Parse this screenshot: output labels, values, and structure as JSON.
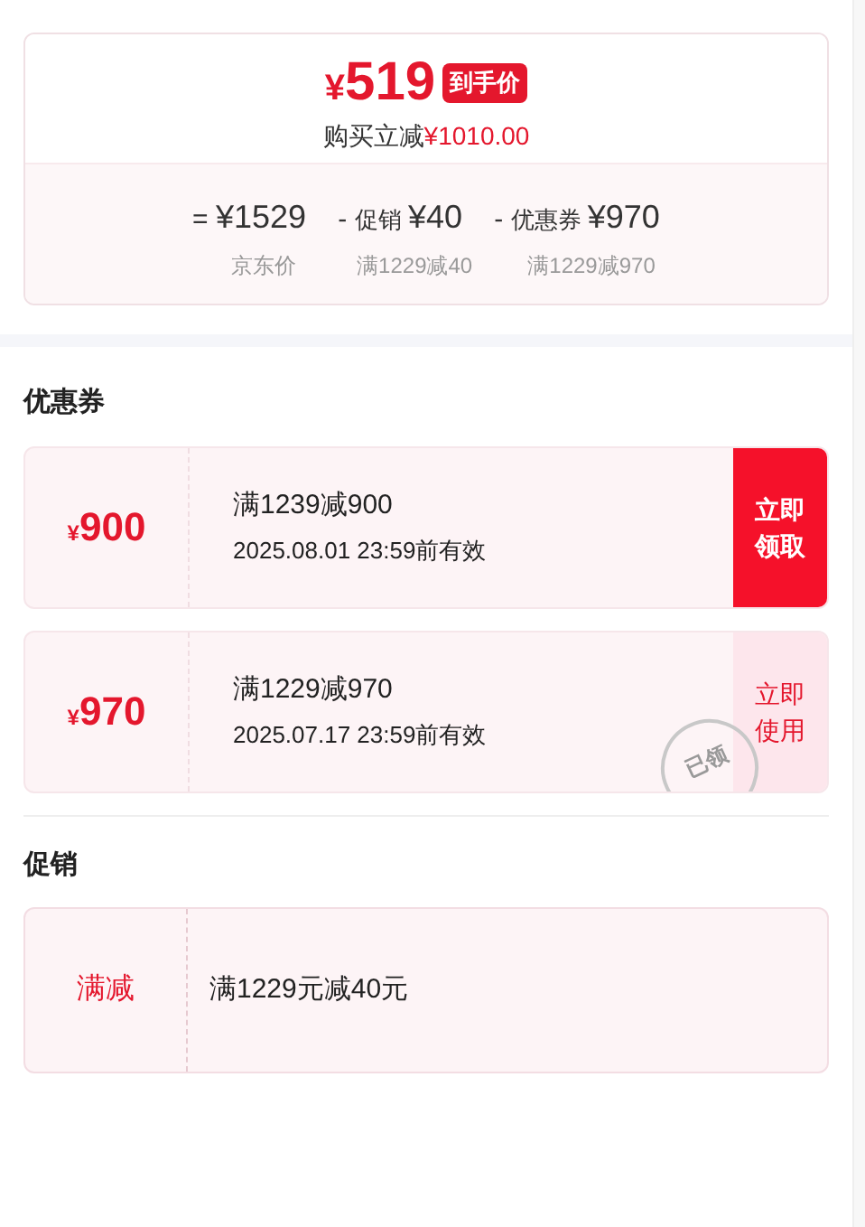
{
  "summary": {
    "currency": "¥",
    "price": "519",
    "badge": "到手价",
    "saving_label": "购买立减",
    "saving_value": "¥1010.00",
    "breakdown": [
      {
        "sign": "=",
        "amount": "¥1529",
        "note": "京东价"
      },
      {
        "sign": "-",
        "label": "促销",
        "amount": "¥40",
        "note": "满1229减40"
      },
      {
        "sign": "-",
        "label": "优惠券",
        "amount": "¥970",
        "note": "满1229减970"
      }
    ]
  },
  "coupons": {
    "title": "优惠券",
    "items": [
      {
        "currency": "¥",
        "amount": "900",
        "condition": "满1239减900",
        "validity": "2025.08.01 23:59前有效",
        "action": "立即领取",
        "claimed": false
      },
      {
        "currency": "¥",
        "amount": "970",
        "condition": "满1229减970",
        "validity": "2025.07.17 23:59前有效",
        "action": "立即使用",
        "claimed": true,
        "stamp": "已领"
      }
    ]
  },
  "promotions": {
    "title": "促销",
    "items": [
      {
        "type": "满减",
        "description": "满1229元减40元"
      }
    ]
  }
}
